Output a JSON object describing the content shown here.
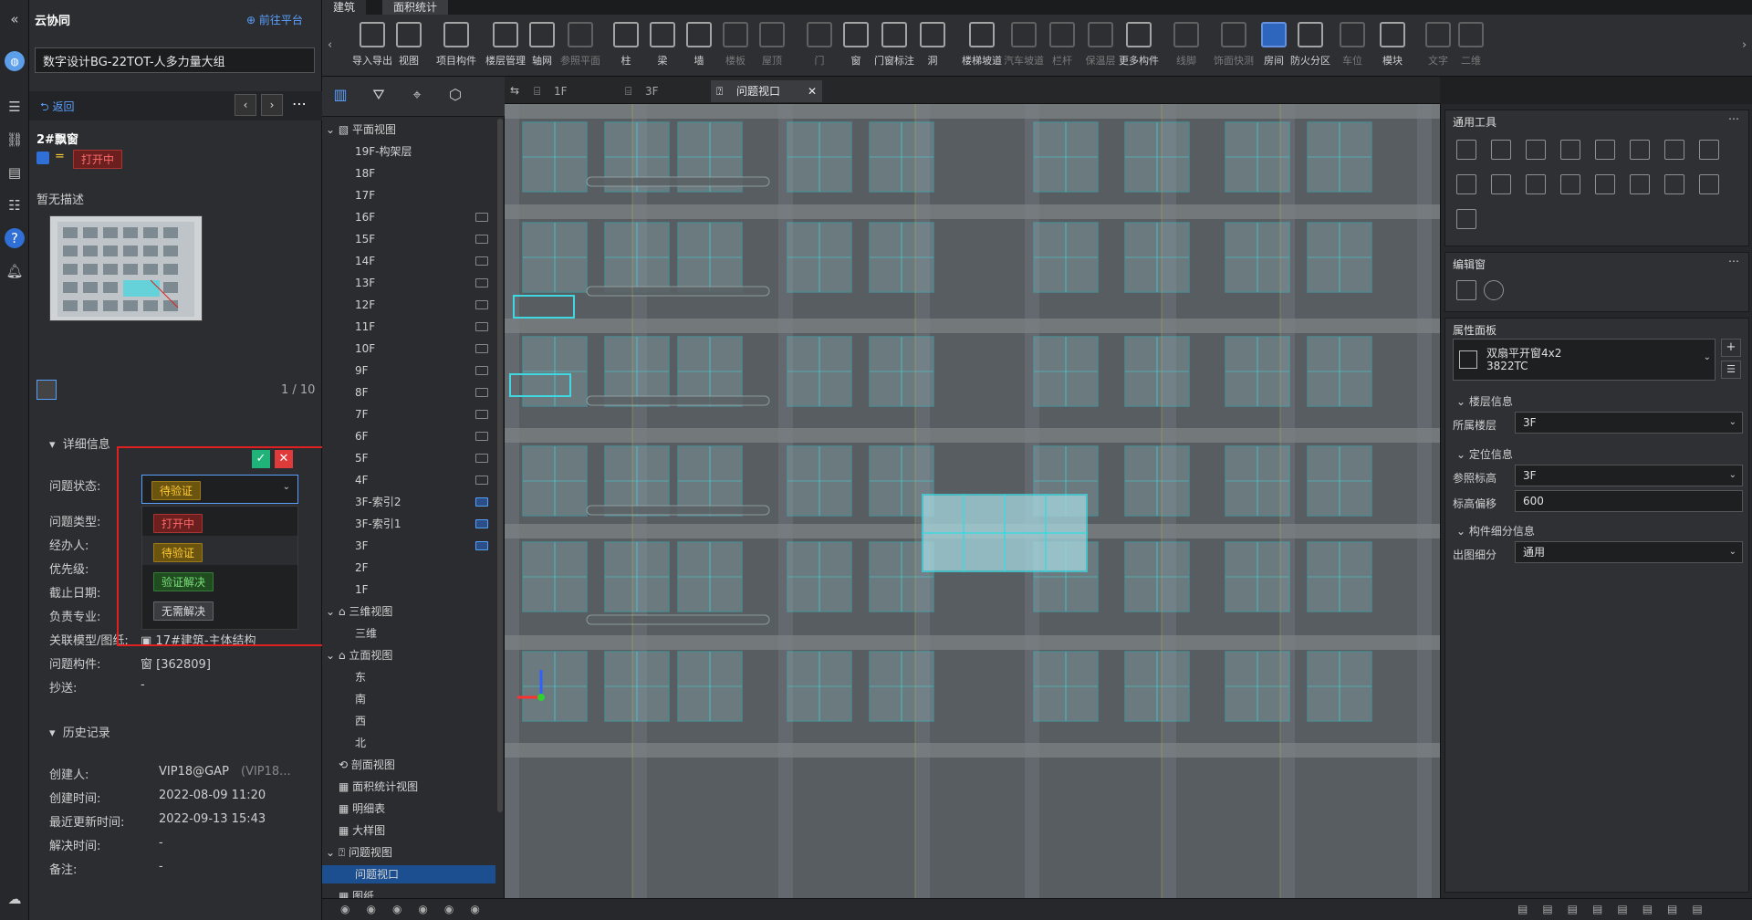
{
  "app": {
    "title": "云协同",
    "platform_link": "前往平台"
  },
  "project": {
    "name": "数字设计BG-22TOT-人多力量大组"
  },
  "nav": {
    "back": "返回",
    "more": "⋯"
  },
  "issue": {
    "title": "2#飘窗",
    "status_badge": "打开中",
    "description": "暂无描述",
    "page_counter": "1 / 10",
    "details_header": "详细信息",
    "fields": {
      "status_label": "问题状态:",
      "type_label": "问题类型:",
      "handler_label": "经办人:",
      "priority_label": "优先级:",
      "deadline_label": "截止日期:",
      "discipline_label": "负责专业:",
      "model_label": "关联模型/图纸:",
      "model_value": "17#建筑-主体结构",
      "component_label": "问题构件:",
      "component_value": "窗 [362809]",
      "cc_label": "抄送:",
      "cc_value": "-"
    },
    "status_dropdown": {
      "selected": "待验证",
      "options": [
        "打开中",
        "待验证",
        "验证解决",
        "无需解决"
      ]
    },
    "history_header": "历史记录",
    "history": {
      "creator_label": "创建人:",
      "creator_value": "VIP18@GAP",
      "creator_extra": "(VIP18...",
      "created_label": "创建时间:",
      "created_value": "2022-08-09 11:20",
      "updated_label": "最近更新时间:",
      "updated_value": "2022-09-13 15:43",
      "resolved_label": "解决时间:",
      "resolved_value": "-",
      "note_label": "备注:",
      "note_value": "-"
    }
  },
  "top_tabs": [
    "建筑",
    "面积统计"
  ],
  "toolbar": [
    {
      "label": "导入导出"
    },
    {
      "label": "视图"
    },
    {
      "label": "项目构件"
    },
    {
      "label": "楼层管理"
    },
    {
      "label": "轴网"
    },
    {
      "label": "参照平面",
      "dim": true
    },
    {
      "label": "柱"
    },
    {
      "label": "梁"
    },
    {
      "label": "墙"
    },
    {
      "label": "楼板",
      "dim": true
    },
    {
      "label": "屋顶",
      "dim": true
    },
    {
      "label": "门",
      "dim": true
    },
    {
      "label": "窗"
    },
    {
      "label": "门窗标注"
    },
    {
      "label": "洞"
    },
    {
      "label": "楼梯坡道"
    },
    {
      "label": "汽车坡道",
      "dim": true
    },
    {
      "label": "栏杆",
      "dim": true
    },
    {
      "label": "保温层",
      "dim": true
    },
    {
      "label": "更多构件"
    },
    {
      "label": "线脚",
      "dim": true
    },
    {
      "label": "饰面快测",
      "dim": true
    },
    {
      "label": "房间",
      "active": true
    },
    {
      "label": "防火分区"
    },
    {
      "label": "车位",
      "dim": true
    },
    {
      "label": "模块"
    },
    {
      "label": "文字",
      "dim": true
    },
    {
      "label": "二维",
      "dim": true
    }
  ],
  "tree": {
    "plan_header": "平面视图",
    "floors": [
      "19F-构架层",
      "18F",
      "17F",
      "16F",
      "15F",
      "14F",
      "13F",
      "12F",
      "11F",
      "10F",
      "9F",
      "8F",
      "7F",
      "6F",
      "5F",
      "4F",
      "3F-索引2",
      "3F-索引1",
      "3F",
      "2F",
      "1F"
    ],
    "three_d_header": "三维视图",
    "three_d_item": "三维",
    "elev_header": "立面视图",
    "elev_items": [
      "东",
      "南",
      "西",
      "北"
    ],
    "section": "剖面视图",
    "area": "面积统计视图",
    "schedule": "明细表",
    "detail": "大样图",
    "issue_header": "问题视图",
    "issue_item": "问题视口",
    "extra": "图纸"
  },
  "view_tabs": [
    "1F",
    "3F",
    "问题视口"
  ],
  "right": {
    "common_tools": "通用工具",
    "edit_window": "编辑窗",
    "property_panel": "属性面板",
    "type_name_1": "双扇平开窗4x2",
    "type_name_2": "3822TC",
    "floor_info": "楼层信息",
    "floor_label": "所属楼层",
    "floor_value": "3F",
    "loc_info": "定位信息",
    "ref_label": "参照标高",
    "ref_value": "3F",
    "offset_label": "标高偏移",
    "offset_value": "600",
    "detail_info": "构件细分信息",
    "out_label": "出图细分",
    "out_value": "通用"
  },
  "colors": {
    "accent": "#2f6fd6",
    "highlight_cyan": "#3fd7e0",
    "red_box": "#e02020"
  }
}
